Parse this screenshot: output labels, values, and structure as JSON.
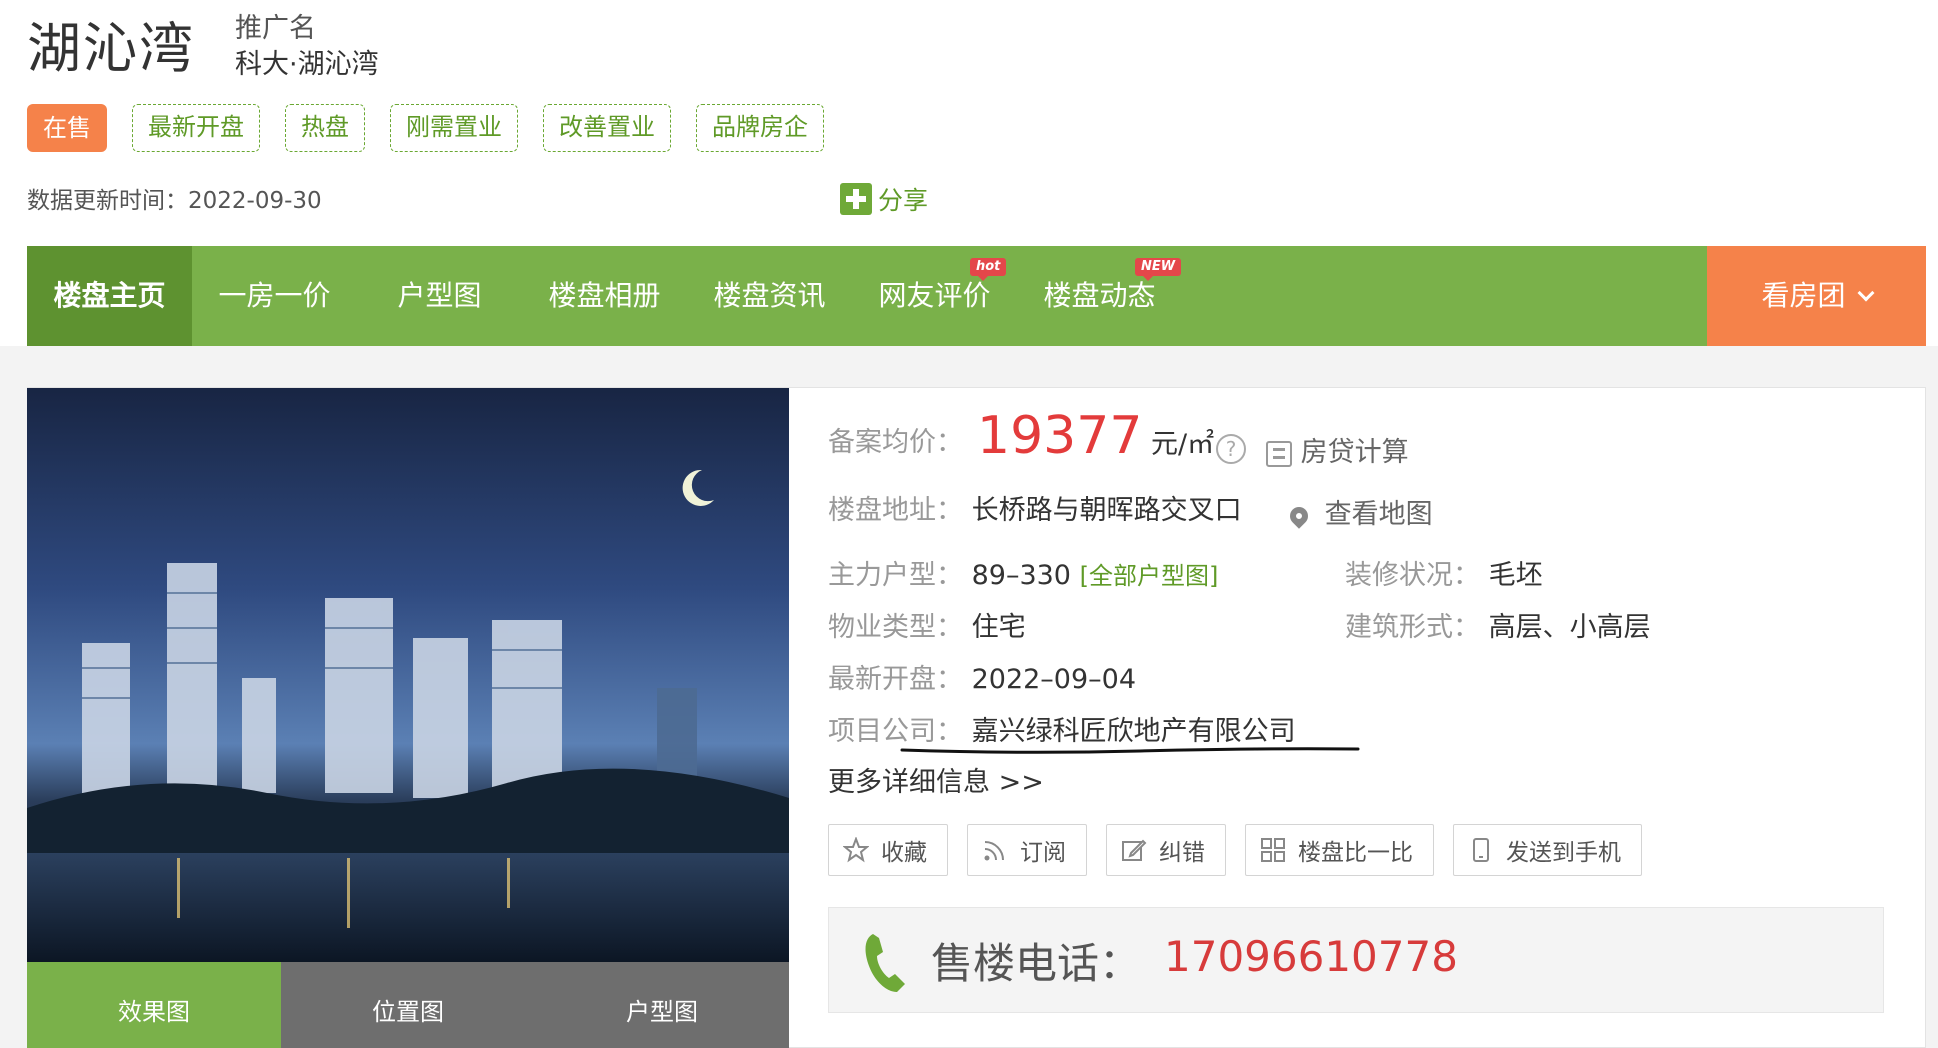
{
  "header": {
    "title": "湖沁湾",
    "promo_label": "推广名",
    "promo_name": "科大·湖沁湾"
  },
  "tags": [
    "在售",
    "最新开盘",
    "热盘",
    "刚需置业",
    "改善置业",
    "品牌房企"
  ],
  "update": {
    "text": "数据更新时间：2022-09-30"
  },
  "share": {
    "label": "分享"
  },
  "nav": {
    "items": [
      "楼盘主页",
      "一房一价",
      "户型图",
      "楼盘相册",
      "楼盘资讯",
      "网友评价",
      "楼盘动态"
    ],
    "badges": {
      "hot": "hot",
      "new": "NEW"
    },
    "tour": "看房团"
  },
  "photo_tabs": [
    "效果图",
    "位置图",
    "户型图"
  ],
  "info": {
    "price_label": "备案均价：",
    "price": "19377",
    "price_unit": "元/㎡",
    "mortgage": "房贷计算",
    "address_label": "楼盘地址：",
    "address": "长桥路与朝晖路交叉口",
    "map_link": "查看地图",
    "layout_label": "主力户型：",
    "layout": "89–330",
    "all_layouts": "[全部户型图]",
    "decor_label": "装修状况：",
    "decor": "毛坯",
    "property_label": "物业类型：",
    "property": "住宅",
    "building_label": "建筑形式：",
    "building": "高层、小高层",
    "open_label": "最新开盘：",
    "open": "2022–09–04",
    "company_label": "项目公司：",
    "company": "嘉兴绿科匠欣地产有限公司",
    "more": "更多详细信息 >>"
  },
  "buttons": [
    "收藏",
    "订阅",
    "纠错",
    "楼盘比一比",
    "发送到手机"
  ],
  "phone": {
    "label": "售楼电话：",
    "number": "17096610778"
  },
  "colors": {
    "green": "#7ab14a",
    "dark_green": "#5e9230",
    "orange": "#f5824a",
    "red": "#e33b3b"
  }
}
